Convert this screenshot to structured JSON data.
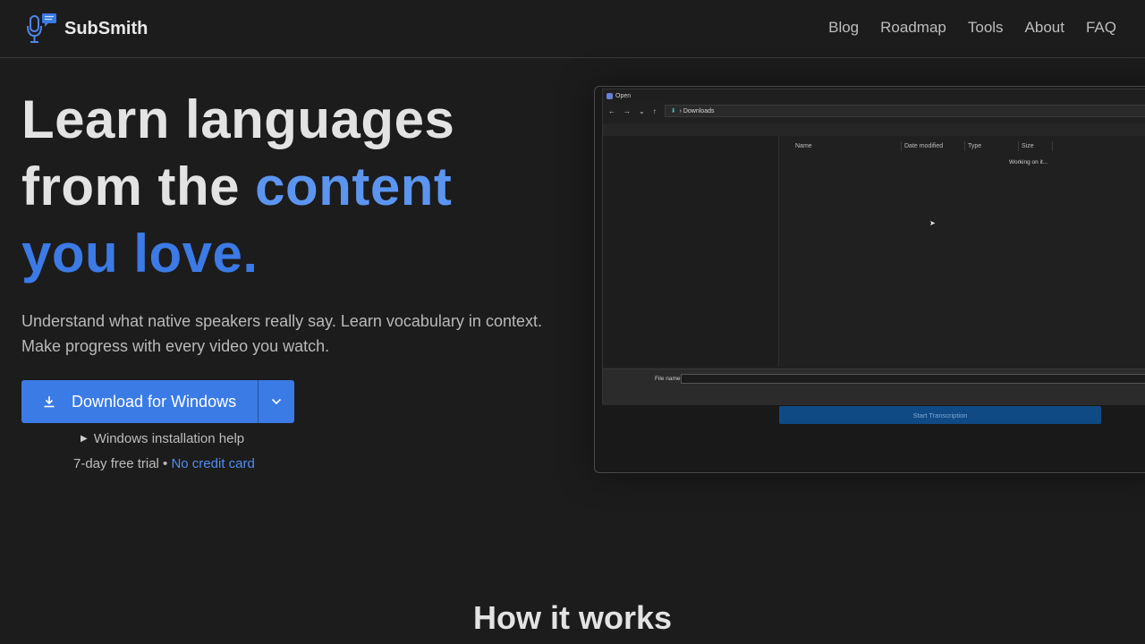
{
  "brand": {
    "name": "SubSmith"
  },
  "nav": {
    "items": [
      "Blog",
      "Roadmap",
      "Tools",
      "About",
      "FAQ"
    ]
  },
  "hero": {
    "title_line1": "Learn languages",
    "title_line2a": "from the ",
    "title_line2b": "content",
    "title_line3": "you love.",
    "subtitle_line1": "Understand what native speakers really say. Learn vocabulary in context.",
    "subtitle_line2": "Make progress with every video you watch."
  },
  "download": {
    "label": "Download for Windows",
    "icon": "download-icon",
    "caret_icon": "chevron-down-icon"
  },
  "help": {
    "label": "Windows installation help"
  },
  "trial": {
    "text": "7-day free trial • ",
    "link": "No credit card"
  },
  "screenshot": {
    "dialog_title": "Open",
    "address": "Downloads",
    "columns": [
      "Name",
      "Date modified",
      "Type",
      "Size"
    ],
    "status": "Working on it...",
    "file_name_label": "File name:",
    "start_button": "Start Transcription"
  },
  "section": {
    "how_title": "How it works"
  },
  "colors": {
    "accent": "#3b7be6",
    "accent_light": "#5b95f0",
    "background": "#1c1c1c"
  }
}
